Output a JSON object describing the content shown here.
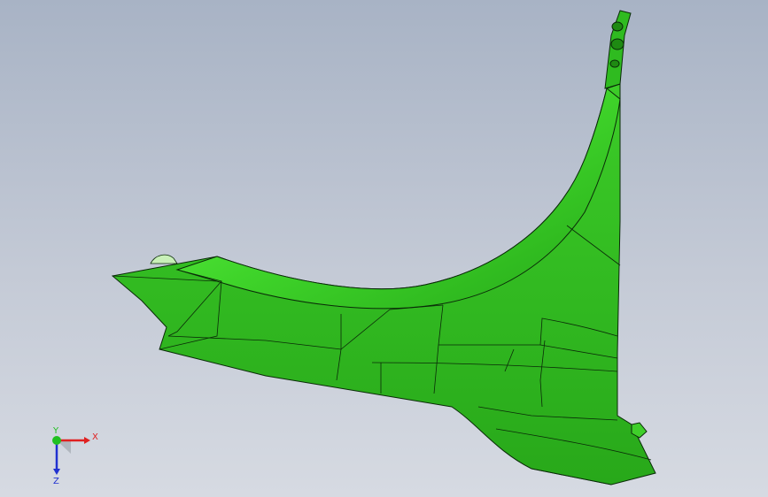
{
  "viewport": {
    "background_top": "#a8b3c5",
    "background_bottom": "#d6dae2"
  },
  "model": {
    "part": "fender",
    "body_color": "#33cc22",
    "highlight_color": "#66ff44",
    "shadow_color": "#1f9a14",
    "edge_color": "#0a2a08"
  },
  "triad": {
    "x_label": "X",
    "y_label": "Y",
    "z_label": "Z",
    "x_color": "#e02020",
    "y_color": "#20c020",
    "z_color": "#2030d0"
  }
}
